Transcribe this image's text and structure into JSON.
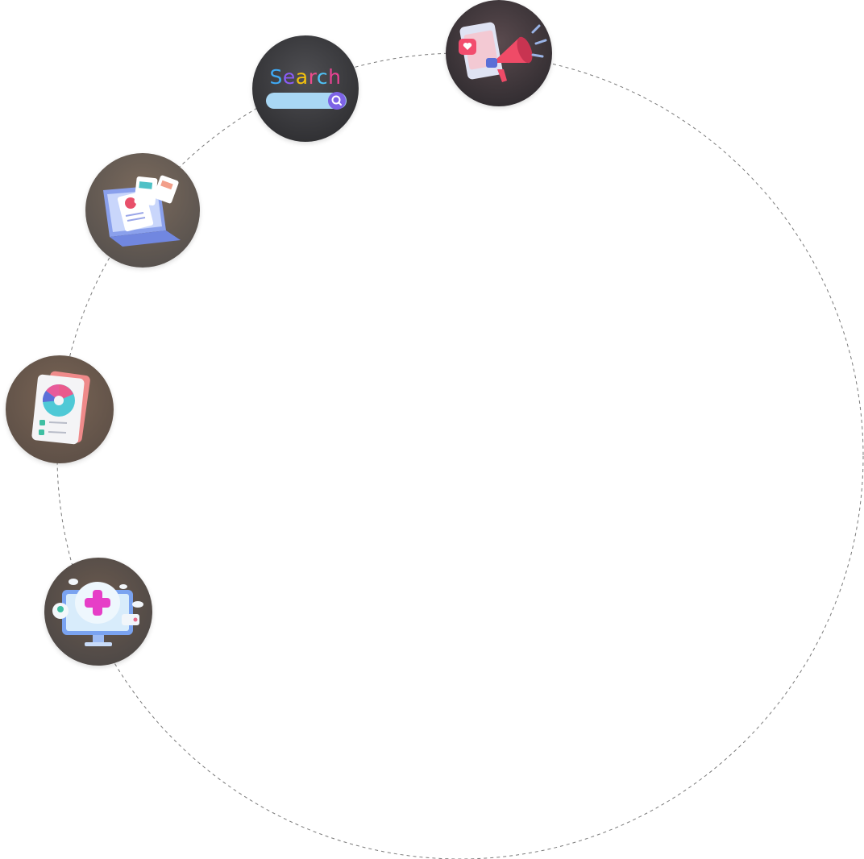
{
  "search_node": {
    "word": "Search",
    "letter_colors": [
      "#3fa9f5",
      "#8a5cf6",
      "#f4c20d",
      "#ec4c8c",
      "#4fc3f7",
      "#e84393"
    ]
  },
  "nodes": [
    {
      "id": "megaphone",
      "icon": "megaphone-icon"
    },
    {
      "id": "search",
      "icon": "search-bar-icon"
    },
    {
      "id": "laptop",
      "icon": "laptop-documents-icon"
    },
    {
      "id": "report",
      "icon": "pie-chart-report-icon"
    },
    {
      "id": "health",
      "icon": "medical-monitor-icon"
    }
  ],
  "colors": {
    "orbit_dash": "#7a7a7a",
    "node_bg_dark": "#4a4a4d",
    "node_bg_warm": "#6e5a4c"
  }
}
